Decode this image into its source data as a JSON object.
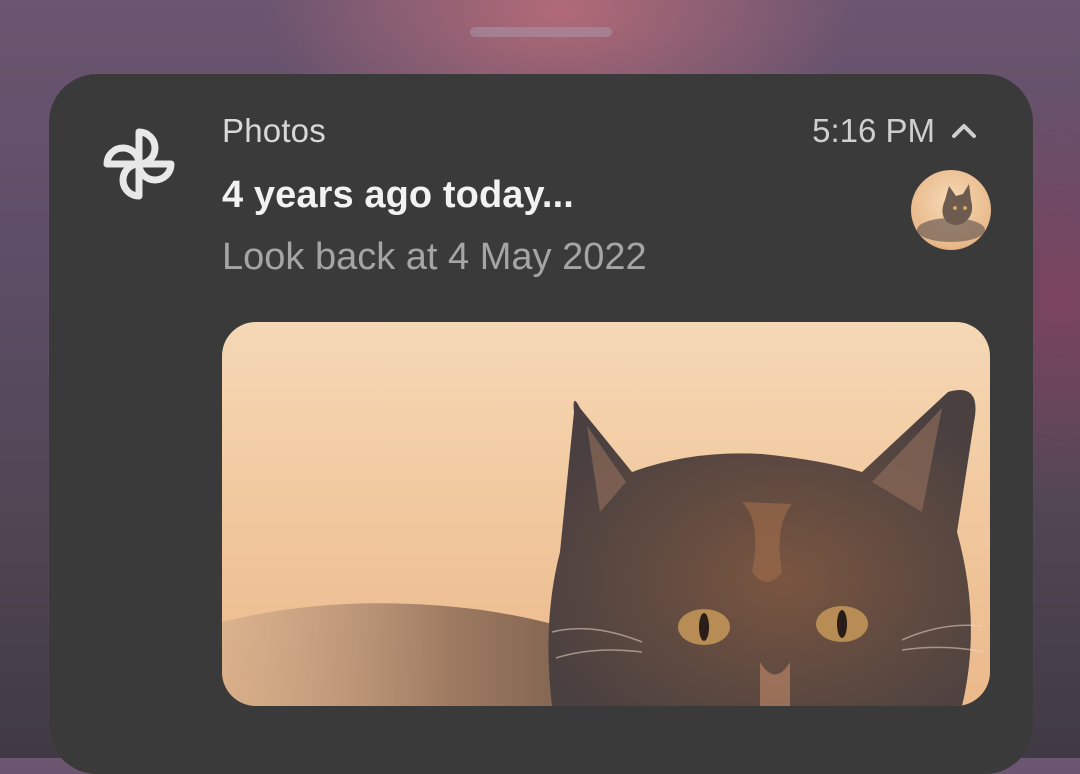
{
  "notification": {
    "app_name": "Photos",
    "app_icon": "pinwheel-icon",
    "time": "5:16 PM",
    "collapse_icon": "chevron-up-icon",
    "title": "4 years ago today...",
    "text": "Look back at 4 May 2022"
  },
  "colors": {
    "card_background": "#3a3a3a",
    "title": "#f2f2f2",
    "secondary_text": "#a5a5a5"
  }
}
